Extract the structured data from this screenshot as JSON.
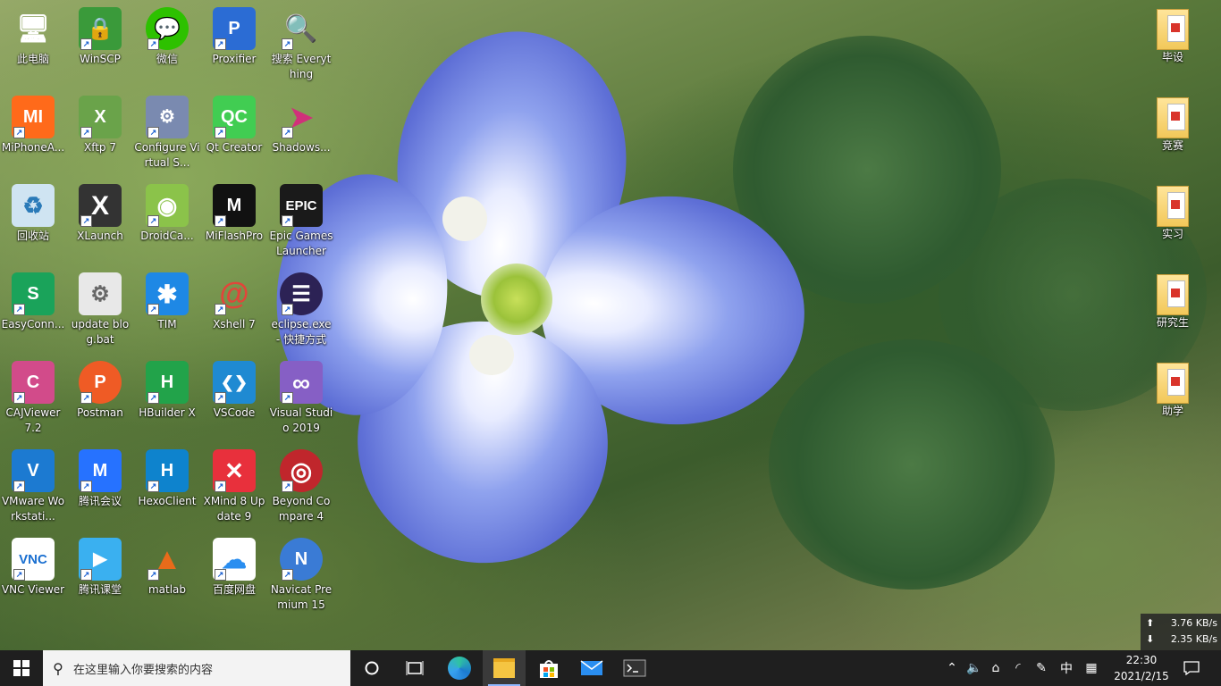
{
  "desktop": {
    "icons_col1": [
      {
        "label": "此电脑",
        "icon": "computer-icon",
        "bg": "#2f9be8",
        "text": "🖥"
      },
      {
        "label": "MiPhoneA...",
        "icon": "mi-icon",
        "bg": "#ff6a1a",
        "text": "MI"
      },
      {
        "label": "回收站",
        "icon": "recycle-bin-icon",
        "bg": "#9ec9e8",
        "text": "♻"
      },
      {
        "label": "EasyConn...",
        "icon": "easyconnect-icon",
        "bg": "#1aa35a",
        "text": "S"
      },
      {
        "label": "CAJViewer 7.2",
        "icon": "cajviewer-icon",
        "bg": "#d24b8a",
        "text": "C"
      },
      {
        "label": "VMware Workstati...",
        "icon": "vmware-icon",
        "bg": "#1c7ad1",
        "text": "V"
      },
      {
        "label": "VNC Viewer",
        "icon": "vnc-icon",
        "bg": "#ffffff",
        "text": "VNC"
      }
    ],
    "icons_col2": [
      {
        "label": "WinSCP",
        "icon": "winscp-icon",
        "bg": "#3a9a3a",
        "text": "🔒"
      },
      {
        "label": "Xftp 7",
        "icon": "xftp-icon",
        "bg": "#6aa34a",
        "text": "X"
      },
      {
        "label": "XLaunch",
        "icon": "xlaunch-icon",
        "bg": "#333333",
        "text": "X"
      },
      {
        "label": "update blog.bat",
        "icon": "bat-file-icon",
        "bg": "#e8e8e8",
        "text": "⚙"
      },
      {
        "label": "Postman",
        "icon": "postman-icon",
        "bg": "#ef5b25",
        "text": "P"
      },
      {
        "label": "腾讯会议",
        "icon": "tencent-meeting-icon",
        "bg": "#2672ff",
        "text": "M"
      },
      {
        "label": "腾讯课堂",
        "icon": "tencent-classroom-icon",
        "bg": "#3ab0f0",
        "text": "▶"
      }
    ],
    "icons_col3": [
      {
        "label": "微信",
        "icon": "wechat-icon",
        "bg": "#2dc100",
        "text": "💬"
      },
      {
        "label": "Configure Virtual S...",
        "icon": "configure-icon",
        "bg": "#7a8ab0",
        "text": "⚙"
      },
      {
        "label": "DroidCa...",
        "icon": "droidcam-icon",
        "bg": "#8bc34a",
        "text": "◉"
      },
      {
        "label": "TIM",
        "icon": "tim-icon",
        "bg": "#1e88e5",
        "text": "✱"
      },
      {
        "label": "HBuilder X",
        "icon": "hbuilder-icon",
        "bg": "#22a34a",
        "text": "H"
      },
      {
        "label": "HexoClient",
        "icon": "hexo-icon",
        "bg": "#0e83cd",
        "text": "H"
      },
      {
        "label": "matlab",
        "icon": "matlab-icon",
        "bg": "#e86b1a",
        "text": "▲"
      }
    ],
    "icons_col4": [
      {
        "label": "Proxifier",
        "icon": "proxifier-icon",
        "bg": "#2b6cd4",
        "text": "P"
      },
      {
        "label": "Qt Creator",
        "icon": "qt-icon",
        "bg": "#41cd52",
        "text": "QC"
      },
      {
        "label": "MiFlashPro",
        "icon": "miflash-icon",
        "bg": "#111111",
        "text": "M"
      },
      {
        "label": "Xshell 7",
        "icon": "xshell-icon",
        "bg": "#e2453a",
        "text": "@"
      },
      {
        "label": "VSCode",
        "icon": "vscode-icon",
        "bg": "#1f8ad2",
        "text": "❮❯"
      },
      {
        "label": "XMind 8 Update 9",
        "icon": "xmind-icon",
        "bg": "#e8303c",
        "text": "✕"
      },
      {
        "label": "百度网盘",
        "icon": "baidu-netdisk-icon",
        "bg": "#ffffff",
        "text": "☁"
      }
    ],
    "icons_col5": [
      {
        "label": "搜索 Everything",
        "icon": "everything-search-icon",
        "bg": "#f08a1a",
        "text": "🔍"
      },
      {
        "label": "Shadows...",
        "icon": "shadowsocks-icon",
        "bg": "#d0307a",
        "text": "➤"
      },
      {
        "label": "Epic Games Launcher",
        "icon": "epic-games-icon",
        "bg": "#1a1a1a",
        "text": "EPIC"
      },
      {
        "label": "eclipse.exe - 快捷方式",
        "icon": "eclipse-icon",
        "bg": "#2c2255",
        "text": "☰"
      },
      {
        "label": "Visual Studio 2019",
        "icon": "visual-studio-icon",
        "bg": "#865fc5",
        "text": "∞"
      },
      {
        "label": "Beyond Compare 4",
        "icon": "beyond-compare-icon",
        "bg": "#c0262c",
        "text": "◎"
      },
      {
        "label": "Navicat Premium 15",
        "icon": "navicat-icon",
        "bg": "#3a7bd5",
        "text": "N"
      }
    ],
    "folders_right": [
      {
        "label": "毕设"
      },
      {
        "label": "竞赛"
      },
      {
        "label": "实习"
      },
      {
        "label": "研究生"
      },
      {
        "label": "助学"
      }
    ]
  },
  "netspeed": {
    "up": "3.76 KB/s",
    "down": "2.35 KB/s",
    "up_arrow": "⬆",
    "down_arrow": "⬇"
  },
  "taskbar": {
    "search_placeholder": "在这里输入你要搜索的内容",
    "ime": "中",
    "time": "22:30",
    "date": "2021/2/15"
  }
}
